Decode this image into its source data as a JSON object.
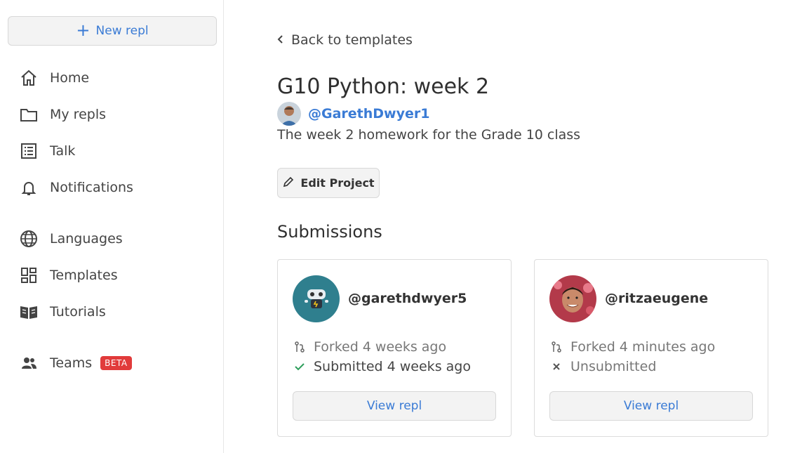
{
  "sidebar": {
    "new_repl_label": "New repl",
    "items": [
      {
        "label": "Home",
        "icon": "home-icon"
      },
      {
        "label": "My repls",
        "icon": "folder-icon"
      },
      {
        "label": "Talk",
        "icon": "list-icon"
      },
      {
        "label": "Notifications",
        "icon": "bell-icon"
      },
      {
        "label": "Languages",
        "icon": "globe-icon"
      },
      {
        "label": "Templates",
        "icon": "templates-icon"
      },
      {
        "label": "Tutorials",
        "icon": "book-icon"
      },
      {
        "label": "Teams",
        "icon": "people-icon",
        "badge": "BETA"
      }
    ]
  },
  "main": {
    "back_label": "Back to templates",
    "title": "G10 Python: week 2",
    "author": "@GarethDwyer1",
    "description": "The week 2 homework for the Grade 10 class",
    "edit_label": "Edit Project",
    "submissions_title": "Submissions",
    "submissions": [
      {
        "username": "@garethdwyer5",
        "forked": "Forked 4 weeks ago",
        "status": "Submitted 4 weeks ago",
        "status_icon": "check-icon",
        "view_label": "View repl"
      },
      {
        "username": "@ritzaeugene",
        "forked": "Forked 4 minutes ago",
        "status": "Unsubmitted",
        "status_icon": "x-icon",
        "view_label": "View repl"
      }
    ]
  },
  "colors": {
    "accent": "#3a7bd5",
    "beta_badge": "#e13b3b",
    "check": "#2e9e5b"
  }
}
